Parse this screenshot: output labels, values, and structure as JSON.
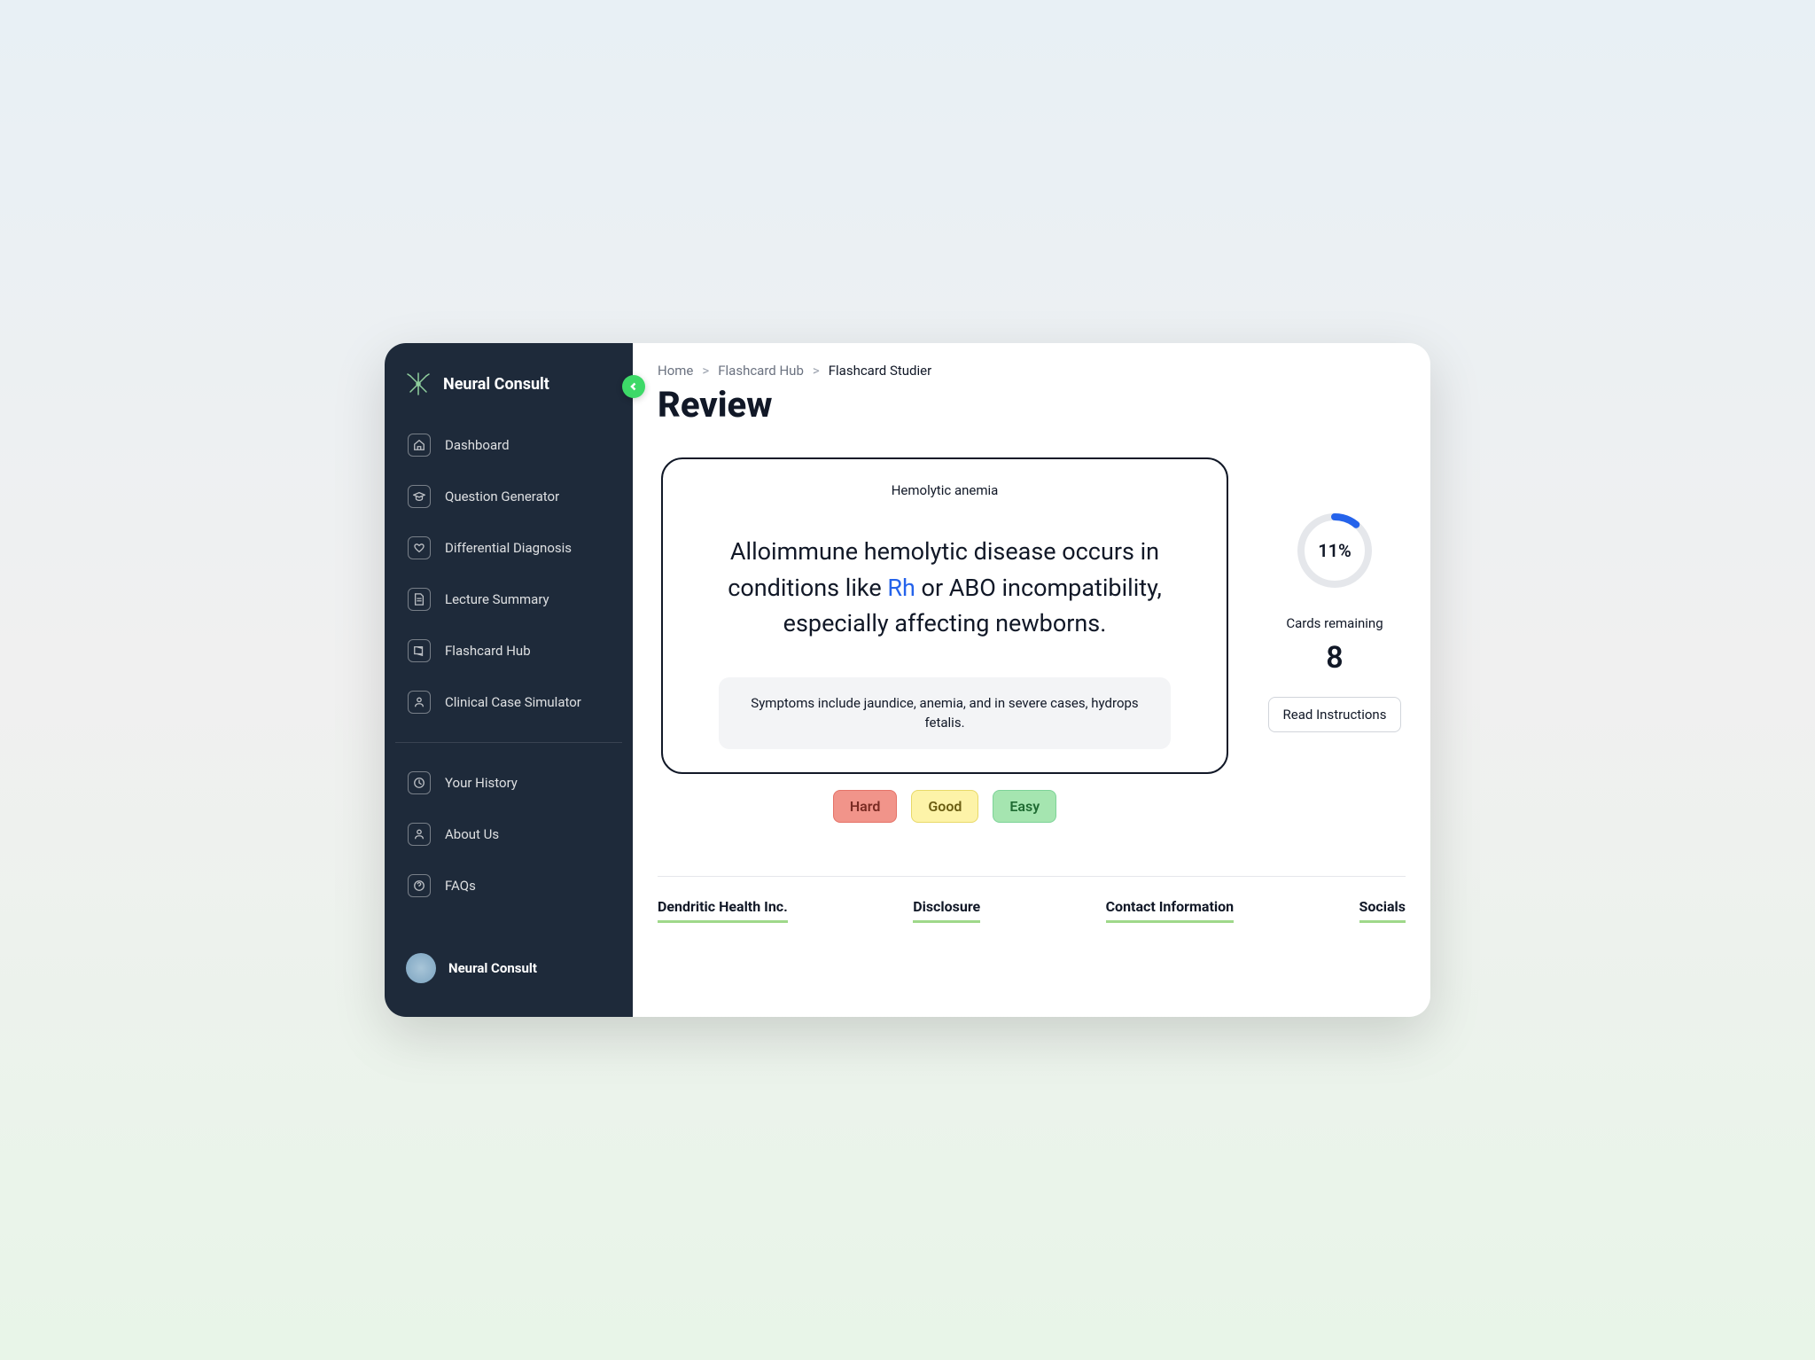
{
  "brand": {
    "name": "Neural Consult",
    "footer_name": "Neural Consult"
  },
  "sidebar": {
    "items": [
      {
        "label": "Dashboard"
      },
      {
        "label": "Question Generator"
      },
      {
        "label": "Differential Diagnosis"
      },
      {
        "label": "Lecture Summary"
      },
      {
        "label": "Flashcard Hub"
      },
      {
        "label": "Clinical Case Simulator"
      }
    ],
    "secondary": [
      {
        "label": "Your History"
      },
      {
        "label": "About Us"
      },
      {
        "label": "FAQs"
      }
    ]
  },
  "breadcrumb": {
    "items": [
      "Home",
      "Flashcard Hub"
    ],
    "current": "Flashcard Studier",
    "separator": ">"
  },
  "page": {
    "title": "Review"
  },
  "flashcard": {
    "topic": "Hemolytic anemia",
    "body_pre": "Alloimmune hemolytic disease occurs in conditions like ",
    "body_highlight": "Rh",
    "body_post": " or ABO incompatibility, especially affecting newborns.",
    "note": "Symptoms include jaundice, anemia, and in severe cases, hydrops fetalis."
  },
  "ratings": {
    "hard": "Hard",
    "good": "Good",
    "easy": "Easy"
  },
  "stats": {
    "percent_text": "11%",
    "percent_value": 11,
    "remaining_label": "Cards remaining",
    "remaining_value": "8",
    "instructions_label": "Read Instructions"
  },
  "footer": {
    "columns": [
      "Dendritic Health Inc.",
      "Disclosure",
      "Contact Information",
      "Socials"
    ]
  }
}
